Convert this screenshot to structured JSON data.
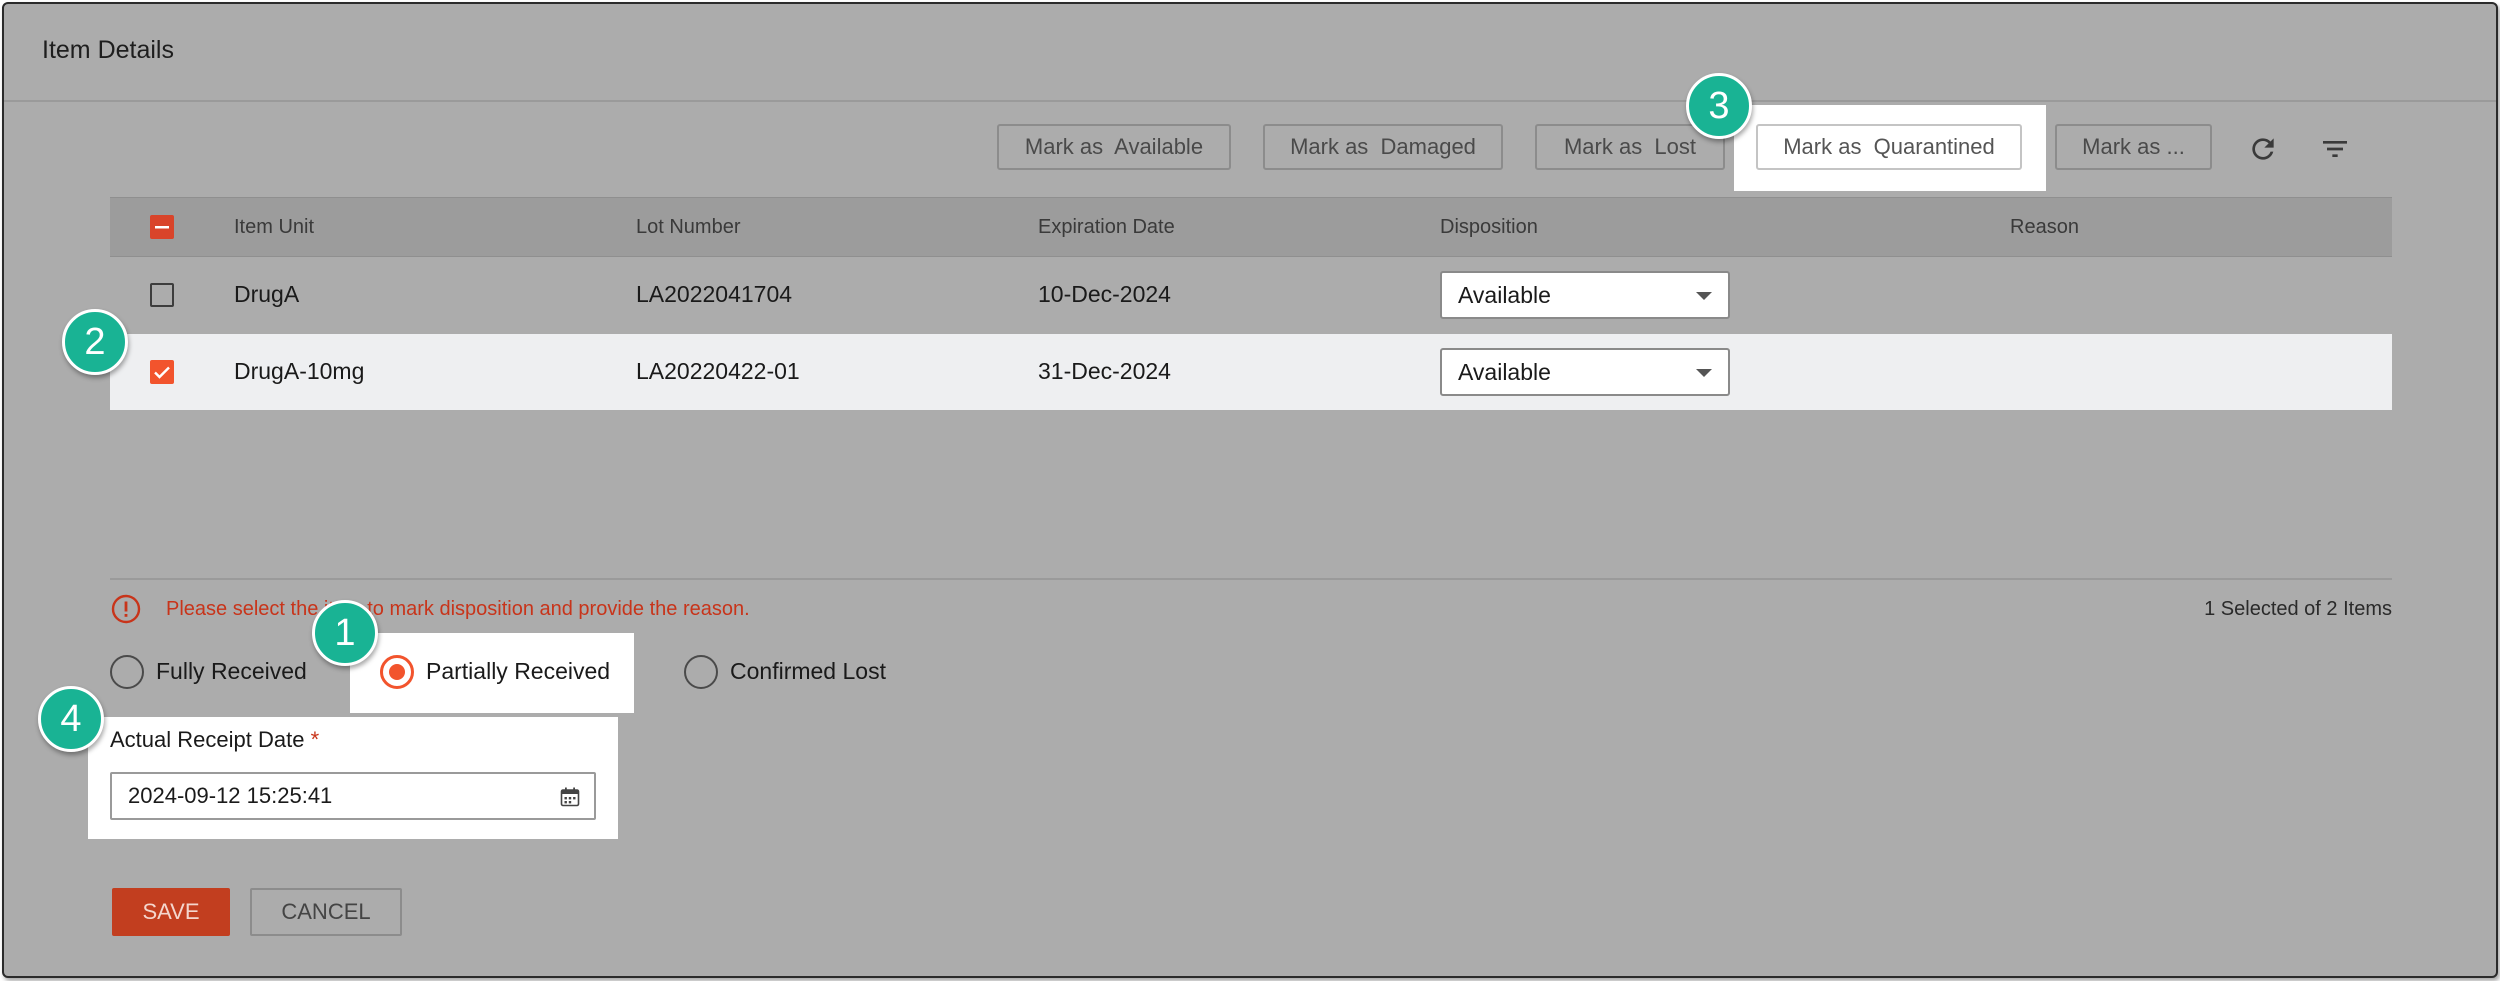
{
  "header": {
    "title": "Item Details"
  },
  "toolbar": {
    "mark_available": "Mark as  Available",
    "mark_damaged": "Mark as  Damaged",
    "mark_lost": "Mark as  Lost",
    "mark_quarantined": "Mark as  Quarantined",
    "mark_more": "Mark as ...",
    "icons": [
      "refresh-icon",
      "filter-icon"
    ]
  },
  "table": {
    "columns": [
      "Item Unit",
      "Lot Number",
      "Expiration Date",
      "Disposition",
      "Reason"
    ],
    "rows": [
      {
        "selected": false,
        "item_unit": "DrugA",
        "lot_number": "LA2022041704",
        "expiration_date": "10-Dec-2024",
        "disposition": "Available",
        "reason": ""
      },
      {
        "selected": true,
        "item_unit": "DrugA-10mg",
        "lot_number": "LA20220422-01",
        "expiration_date": "31-Dec-2024",
        "disposition": "Available",
        "reason": ""
      }
    ]
  },
  "status": {
    "error_message": "Please select the item to mark disposition and provide the reason.",
    "selected_count": "1 Selected of 2 Items"
  },
  "receipt_status": {
    "options": [
      "Fully Received",
      "Partially Received",
      "Confirmed Lost"
    ],
    "selected": "Partially Received"
  },
  "receipt_date": {
    "label": "Actual Receipt Date",
    "required_mark": "*",
    "value": "2024-09-12 15:25:41"
  },
  "actions": {
    "save": "SAVE",
    "cancel": "CANCEL"
  },
  "markers": [
    "1",
    "2",
    "3",
    "4"
  ],
  "colors": {
    "accent": "#f2542d",
    "save_button": "#c23e1f",
    "error": "#c8341a",
    "marker": "#19b394"
  }
}
